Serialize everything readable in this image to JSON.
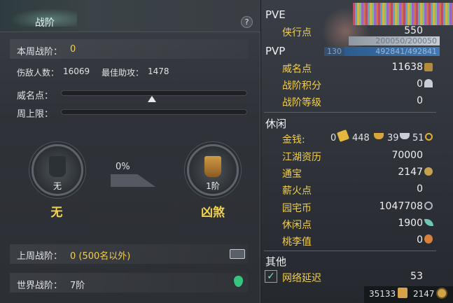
{
  "left": {
    "title": "战阶",
    "help": "?",
    "weekly_rank_label": "本周战阶：",
    "weekly_rank_value": "0",
    "kill_count_label": "伤敌人数：",
    "kill_count_value": "16069",
    "best_assist_label": "最佳助攻：",
    "best_assist_value": "1478",
    "prestige_label": "威名点：",
    "prestige_fill": 0.49,
    "weekly_cap_label": "周上限：",
    "weekly_cap_fill": 0,
    "current_rank_level": "无",
    "current_rank_name": "无",
    "progress_percent": "0%",
    "next_rank_level": "1阶",
    "next_rank_name": "凶煞",
    "last_week_label": "上周战阶：",
    "last_week_value": "0 (500名以外)",
    "world_rank_label": "世界战阶：",
    "world_rank_value": "7阶"
  },
  "right": {
    "pve_header": "PVE",
    "pve_bar_text": "200050/200050",
    "chivalry_label": "侠行点",
    "chivalry_value": "550",
    "pvp_header": "PVP",
    "pvp_level": "130",
    "pvp_bar_text": "492841/492841",
    "prestige_label": "威名点",
    "prestige_value": "11638",
    "rank_points_label": "战阶积分",
    "rank_points_value": "0",
    "rank_level_label": "战阶等级",
    "rank_level_value": "0",
    "leisure_header": "休闲",
    "money_label": "金钱:",
    "money_gold": "0",
    "money_silver_ingot": "448",
    "money_silver": "39",
    "money_copper": "51",
    "jianghu_label": "江湖资历",
    "jianghu_value": "70000",
    "tongbao_label": "通宝",
    "tongbao_value": "2147",
    "firewood_label": "薪火点",
    "firewood_value": "0",
    "estate_label": "园宅币",
    "estate_value": "1047708",
    "leisure_pts_label": "休闲点",
    "leisure_pts_value": "1900",
    "taoli_label": "桃李值",
    "taoli_value": "0",
    "other_header": "其他",
    "latency_label": "网络延迟",
    "latency_value": "53",
    "bottom_value_1": "35133",
    "bottom_value_2": "2147",
    "colors": {
      "accent_yellow": "#f3cf4a",
      "pvp_bar": "#3a6aa0",
      "pve_bar": "#aab2bb"
    }
  }
}
